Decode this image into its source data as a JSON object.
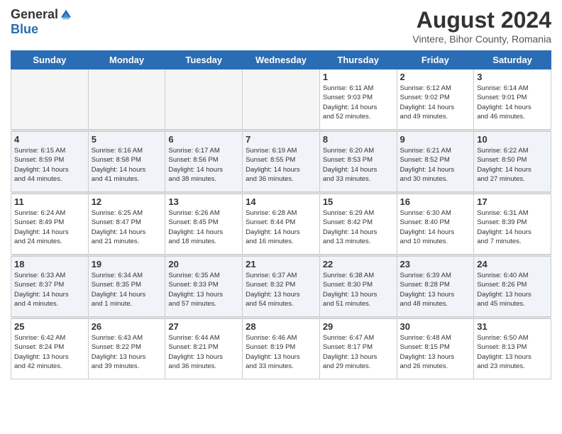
{
  "header": {
    "logo_general": "General",
    "logo_blue": "Blue",
    "month_title": "August 2024",
    "location": "Vintere, Bihor County, Romania"
  },
  "weekdays": [
    "Sunday",
    "Monday",
    "Tuesday",
    "Wednesday",
    "Thursday",
    "Friday",
    "Saturday"
  ],
  "weeks": [
    [
      {
        "day": "",
        "info": ""
      },
      {
        "day": "",
        "info": ""
      },
      {
        "day": "",
        "info": ""
      },
      {
        "day": "",
        "info": ""
      },
      {
        "day": "1",
        "info": "Sunrise: 6:11 AM\nSunset: 9:03 PM\nDaylight: 14 hours\nand 52 minutes."
      },
      {
        "day": "2",
        "info": "Sunrise: 6:12 AM\nSunset: 9:02 PM\nDaylight: 14 hours\nand 49 minutes."
      },
      {
        "day": "3",
        "info": "Sunrise: 6:14 AM\nSunset: 9:01 PM\nDaylight: 14 hours\nand 46 minutes."
      }
    ],
    [
      {
        "day": "4",
        "info": "Sunrise: 6:15 AM\nSunset: 8:59 PM\nDaylight: 14 hours\nand 44 minutes."
      },
      {
        "day": "5",
        "info": "Sunrise: 6:16 AM\nSunset: 8:58 PM\nDaylight: 14 hours\nand 41 minutes."
      },
      {
        "day": "6",
        "info": "Sunrise: 6:17 AM\nSunset: 8:56 PM\nDaylight: 14 hours\nand 38 minutes."
      },
      {
        "day": "7",
        "info": "Sunrise: 6:19 AM\nSunset: 8:55 PM\nDaylight: 14 hours\nand 36 minutes."
      },
      {
        "day": "8",
        "info": "Sunrise: 6:20 AM\nSunset: 8:53 PM\nDaylight: 14 hours\nand 33 minutes."
      },
      {
        "day": "9",
        "info": "Sunrise: 6:21 AM\nSunset: 8:52 PM\nDaylight: 14 hours\nand 30 minutes."
      },
      {
        "day": "10",
        "info": "Sunrise: 6:22 AM\nSunset: 8:50 PM\nDaylight: 14 hours\nand 27 minutes."
      }
    ],
    [
      {
        "day": "11",
        "info": "Sunrise: 6:24 AM\nSunset: 8:49 PM\nDaylight: 14 hours\nand 24 minutes."
      },
      {
        "day": "12",
        "info": "Sunrise: 6:25 AM\nSunset: 8:47 PM\nDaylight: 14 hours\nand 21 minutes."
      },
      {
        "day": "13",
        "info": "Sunrise: 6:26 AM\nSunset: 8:45 PM\nDaylight: 14 hours\nand 18 minutes."
      },
      {
        "day": "14",
        "info": "Sunrise: 6:28 AM\nSunset: 8:44 PM\nDaylight: 14 hours\nand 16 minutes."
      },
      {
        "day": "15",
        "info": "Sunrise: 6:29 AM\nSunset: 8:42 PM\nDaylight: 14 hours\nand 13 minutes."
      },
      {
        "day": "16",
        "info": "Sunrise: 6:30 AM\nSunset: 8:40 PM\nDaylight: 14 hours\nand 10 minutes."
      },
      {
        "day": "17",
        "info": "Sunrise: 6:31 AM\nSunset: 8:39 PM\nDaylight: 14 hours\nand 7 minutes."
      }
    ],
    [
      {
        "day": "18",
        "info": "Sunrise: 6:33 AM\nSunset: 8:37 PM\nDaylight: 14 hours\nand 4 minutes."
      },
      {
        "day": "19",
        "info": "Sunrise: 6:34 AM\nSunset: 8:35 PM\nDaylight: 14 hours\nand 1 minute."
      },
      {
        "day": "20",
        "info": "Sunrise: 6:35 AM\nSunset: 8:33 PM\nDaylight: 13 hours\nand 57 minutes."
      },
      {
        "day": "21",
        "info": "Sunrise: 6:37 AM\nSunset: 8:32 PM\nDaylight: 13 hours\nand 54 minutes."
      },
      {
        "day": "22",
        "info": "Sunrise: 6:38 AM\nSunset: 8:30 PM\nDaylight: 13 hours\nand 51 minutes."
      },
      {
        "day": "23",
        "info": "Sunrise: 6:39 AM\nSunset: 8:28 PM\nDaylight: 13 hours\nand 48 minutes."
      },
      {
        "day": "24",
        "info": "Sunrise: 6:40 AM\nSunset: 8:26 PM\nDaylight: 13 hours\nand 45 minutes."
      }
    ],
    [
      {
        "day": "25",
        "info": "Sunrise: 6:42 AM\nSunset: 8:24 PM\nDaylight: 13 hours\nand 42 minutes."
      },
      {
        "day": "26",
        "info": "Sunrise: 6:43 AM\nSunset: 8:22 PM\nDaylight: 13 hours\nand 39 minutes."
      },
      {
        "day": "27",
        "info": "Sunrise: 6:44 AM\nSunset: 8:21 PM\nDaylight: 13 hours\nand 36 minutes."
      },
      {
        "day": "28",
        "info": "Sunrise: 6:46 AM\nSunset: 8:19 PM\nDaylight: 13 hours\nand 33 minutes."
      },
      {
        "day": "29",
        "info": "Sunrise: 6:47 AM\nSunset: 8:17 PM\nDaylight: 13 hours\nand 29 minutes."
      },
      {
        "day": "30",
        "info": "Sunrise: 6:48 AM\nSunset: 8:15 PM\nDaylight: 13 hours\nand 26 minutes."
      },
      {
        "day": "31",
        "info": "Sunrise: 6:50 AM\nSunset: 8:13 PM\nDaylight: 13 hours\nand 23 minutes."
      }
    ]
  ]
}
